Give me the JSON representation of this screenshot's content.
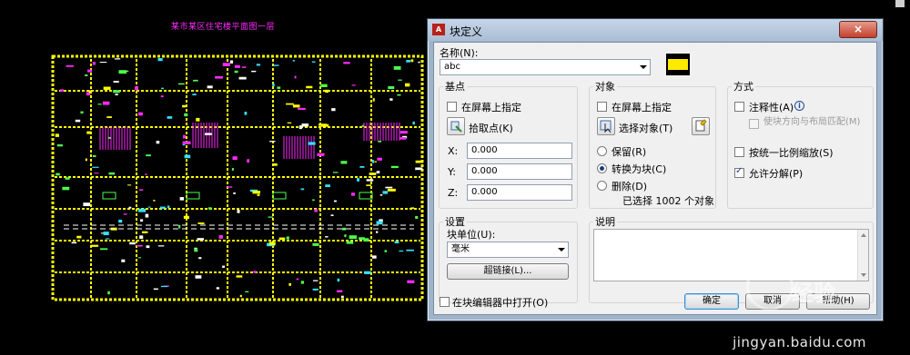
{
  "cad": {
    "title": "某市某区住宅楼平面图一层"
  },
  "dialog": {
    "title": "块定义",
    "close_icon": "×",
    "name_label": "名称(N):",
    "name_value": "abc",
    "base_point": {
      "title": "基点",
      "specify_on_screen": "在屏幕上指定",
      "pick_point": "拾取点(K)",
      "x_label": "X:",
      "x_value": "0.000",
      "y_label": "Y:",
      "y_value": "0.000",
      "z_label": "Z:",
      "z_value": "0.000"
    },
    "objects": {
      "title": "对象",
      "specify_on_screen": "在屏幕上指定",
      "select_objects": "选择对象(T)",
      "retain": "保留(R)",
      "convert_to_block": "转换为块(C)",
      "delete": "删除(D)",
      "selected_count": "已选择 1002 个对象"
    },
    "behavior": {
      "title": "方式",
      "annotative": "注释性(A)",
      "match_orientation": "使块方向与布局匹配(M)",
      "scale_uniformly": "按统一比例缩放(S)",
      "allow_exploding": "允许分解(P)"
    },
    "settings": {
      "title": "设置",
      "block_unit_label": "块单位(U):",
      "block_unit_value": "毫米",
      "hyperlink": "超链接(L)..."
    },
    "description": {
      "title": "说明"
    },
    "open_in_editor": "在块编辑器中打开(O)",
    "ok": "确定",
    "cancel": "取消",
    "help": "帮助(H)"
  },
  "watermark": {
    "logo_text": "经验",
    "url": "jingyan.baidu.com"
  },
  "colors": {
    "cad_yellow": "#ffff00",
    "cad_magenta": "#ff2aff",
    "cad_green": "#4dff4d",
    "cad_cyan": "#34e0ff",
    "cad_white": "#ffffff"
  }
}
